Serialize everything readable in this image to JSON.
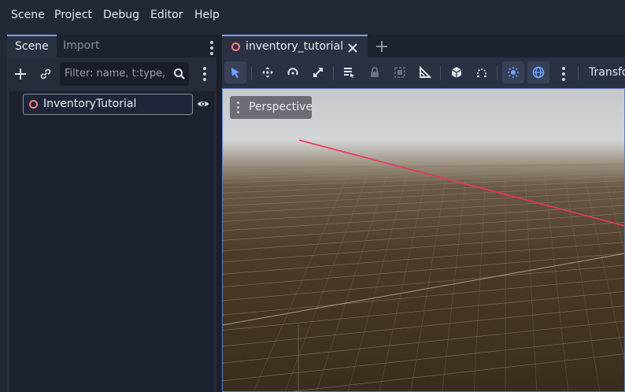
{
  "menu": [
    "Scene",
    "Project",
    "Debug",
    "Editor",
    "Help"
  ],
  "left_dock": {
    "tabs": [
      "Scene",
      "Import"
    ],
    "filter_placeholder": "Filter: name, t:type,",
    "root_node": "InventoryTutorial"
  },
  "editor": {
    "scene_tab": "inventory_tutorial",
    "transform_label": "Transfo",
    "perspective_label": "Perspective"
  },
  "colors": {
    "accent": "#6fa5ff",
    "node_ring": "#fc7f7f",
    "axis_x": "#f0335a"
  },
  "icons": [
    "plus-icon",
    "link-icon",
    "search-icon",
    "eye-icon",
    "close-icon",
    "select-icon",
    "move-icon",
    "rotate-icon",
    "scale-icon",
    "list-select-icon",
    "lock-icon",
    "group-icon",
    "ruler-icon",
    "box-icon",
    "snap-icon",
    "sun-icon",
    "globe-icon"
  ]
}
